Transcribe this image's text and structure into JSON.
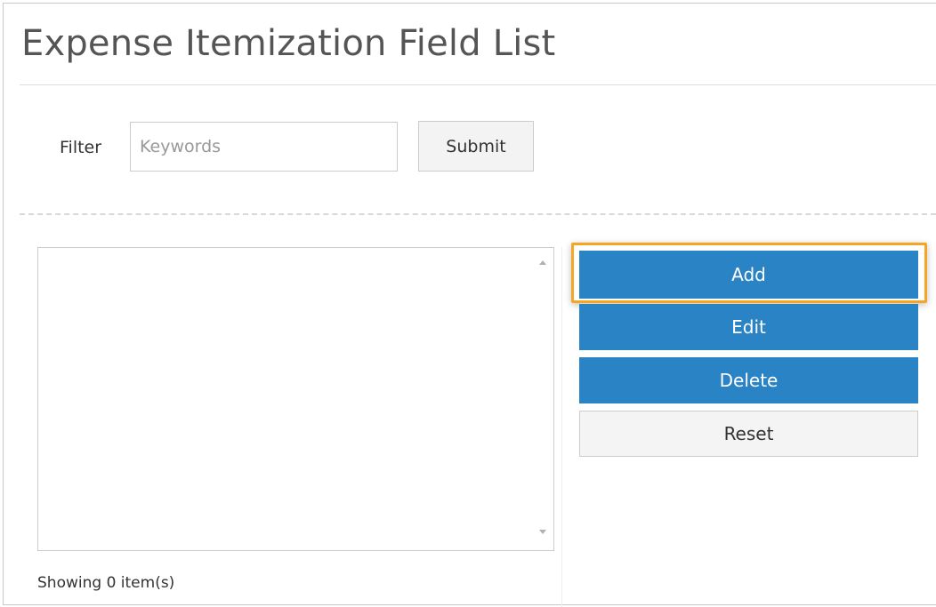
{
  "page": {
    "title": "Expense Itemization Field List"
  },
  "filter": {
    "label": "Filter",
    "placeholder": "Keywords",
    "value": "",
    "submit_label": "Submit"
  },
  "actions": {
    "add_label": "Add",
    "edit_label": "Edit",
    "delete_label": "Delete",
    "reset_label": "Reset"
  },
  "list": {
    "items": [],
    "status_text": "Showing 0 item(s)"
  },
  "colors": {
    "primary": "#2a83c5",
    "highlight": "#f5a623"
  }
}
